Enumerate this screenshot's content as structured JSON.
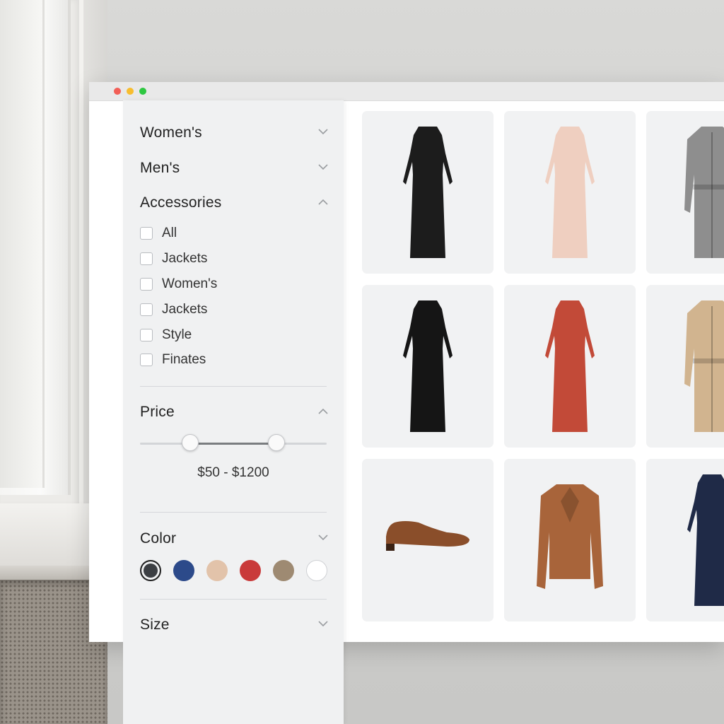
{
  "filters": {
    "categories": [
      {
        "label": "Women's",
        "chevron": "chevron-down-icon"
      },
      {
        "label": "Men's",
        "chevron": "chevron-down-icon"
      },
      {
        "label": "Accessories",
        "chevron": "chevron-up-icon"
      }
    ],
    "accessories_options": [
      "All",
      "Jackets",
      "Women's",
      "Jackets",
      "Style",
      "Finates"
    ],
    "price": {
      "label": "Price",
      "chevron": "chevron-up-icon",
      "range_text": "$50 - $1200",
      "min_fraction": 0.27,
      "max_fraction": 0.73
    },
    "color": {
      "label": "Color",
      "chevron": "chevron-down-icon",
      "swatches": [
        {
          "name": "charcoal",
          "hex": "#3c3f43",
          "selected": true
        },
        {
          "name": "navy",
          "hex": "#2c4a8a",
          "selected": false
        },
        {
          "name": "beige",
          "hex": "#e2c3aa",
          "selected": false
        },
        {
          "name": "red",
          "hex": "#c93a3a",
          "selected": false
        },
        {
          "name": "taupe",
          "hex": "#9e8a72",
          "selected": false
        },
        {
          "name": "white",
          "hex": "#ffffff",
          "selected": false
        }
      ]
    },
    "size": {
      "label": "Size",
      "chevron": "chevron-down-icon"
    }
  },
  "products": [
    {
      "item": "black polka-dot dress",
      "color": "#1c1c1c"
    },
    {
      "item": "blush pleated dress",
      "color": "#efcfc0"
    },
    {
      "item": "grey wool coat",
      "color": "#8e8e8e"
    },
    {
      "item": "black chiffon dress",
      "color": "#151515"
    },
    {
      "item": "rust wrap dress",
      "color": "#c24a38"
    },
    {
      "item": "camel trench coat",
      "color": "#d1b48f"
    },
    {
      "item": "brown leather loafer",
      "color": "#8a4e2a"
    },
    {
      "item": "tan suede jacket",
      "color": "#a8643a"
    },
    {
      "item": "navy shirt dress",
      "color": "#1f2a47"
    }
  ]
}
